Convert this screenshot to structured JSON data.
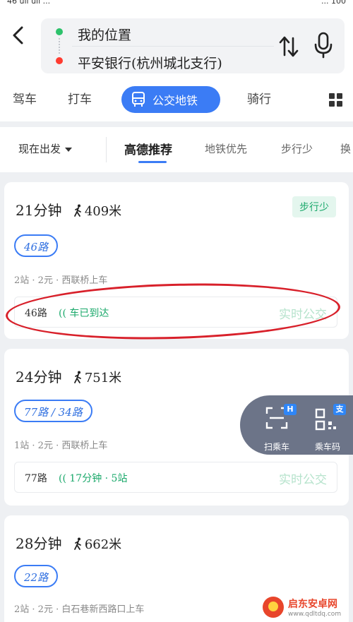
{
  "status_bar": {
    "left_text": "46 ull ull ...",
    "right_text": "... 100"
  },
  "route": {
    "start_label": "我的位置",
    "end_label": "平安银行(杭州城北支行)"
  },
  "modes": {
    "drive_label": "驾车",
    "taxi_label": "打车",
    "transit_label": "公交地铁",
    "bike_label": "骑行"
  },
  "filters": {
    "depart_label": "现在出发",
    "options": [
      "高德推荐",
      "地铁优先",
      "步行少",
      "换"
    ]
  },
  "routes": [
    {
      "duration": "21分钟",
      "walk": "409米",
      "badge": "步行少",
      "lines": "46路",
      "info": "2站 · 2元 · 西联桥上车",
      "realtime_route": "46路",
      "realtime_status": "(( 车已到达",
      "realtime_link": "实时公交"
    },
    {
      "duration": "24分钟",
      "walk": "751米",
      "lines": "77路 / 34路",
      "info": "1站 · 2元 · 西联桥上车",
      "realtime_route": "77路",
      "realtime_status": "(( 17分钟 · 5站",
      "realtime_link": "实时公交"
    },
    {
      "duration": "28分钟",
      "walk": "662米",
      "lines": "22路",
      "info": "2站 · 2元 · 白石巷新西路口上车"
    }
  ],
  "float_panel": {
    "scan_label": "扫乘车",
    "scan_tag": "H",
    "ride_code_label": "乘车码",
    "ride_code_tag": "支"
  },
  "watermark": {
    "title": "启东安卓网",
    "url": "www.qdltdq.com"
  },
  "colors": {
    "accent": "#3b7cf5",
    "success": "#19a86a",
    "annotation": "#d8202a"
  }
}
